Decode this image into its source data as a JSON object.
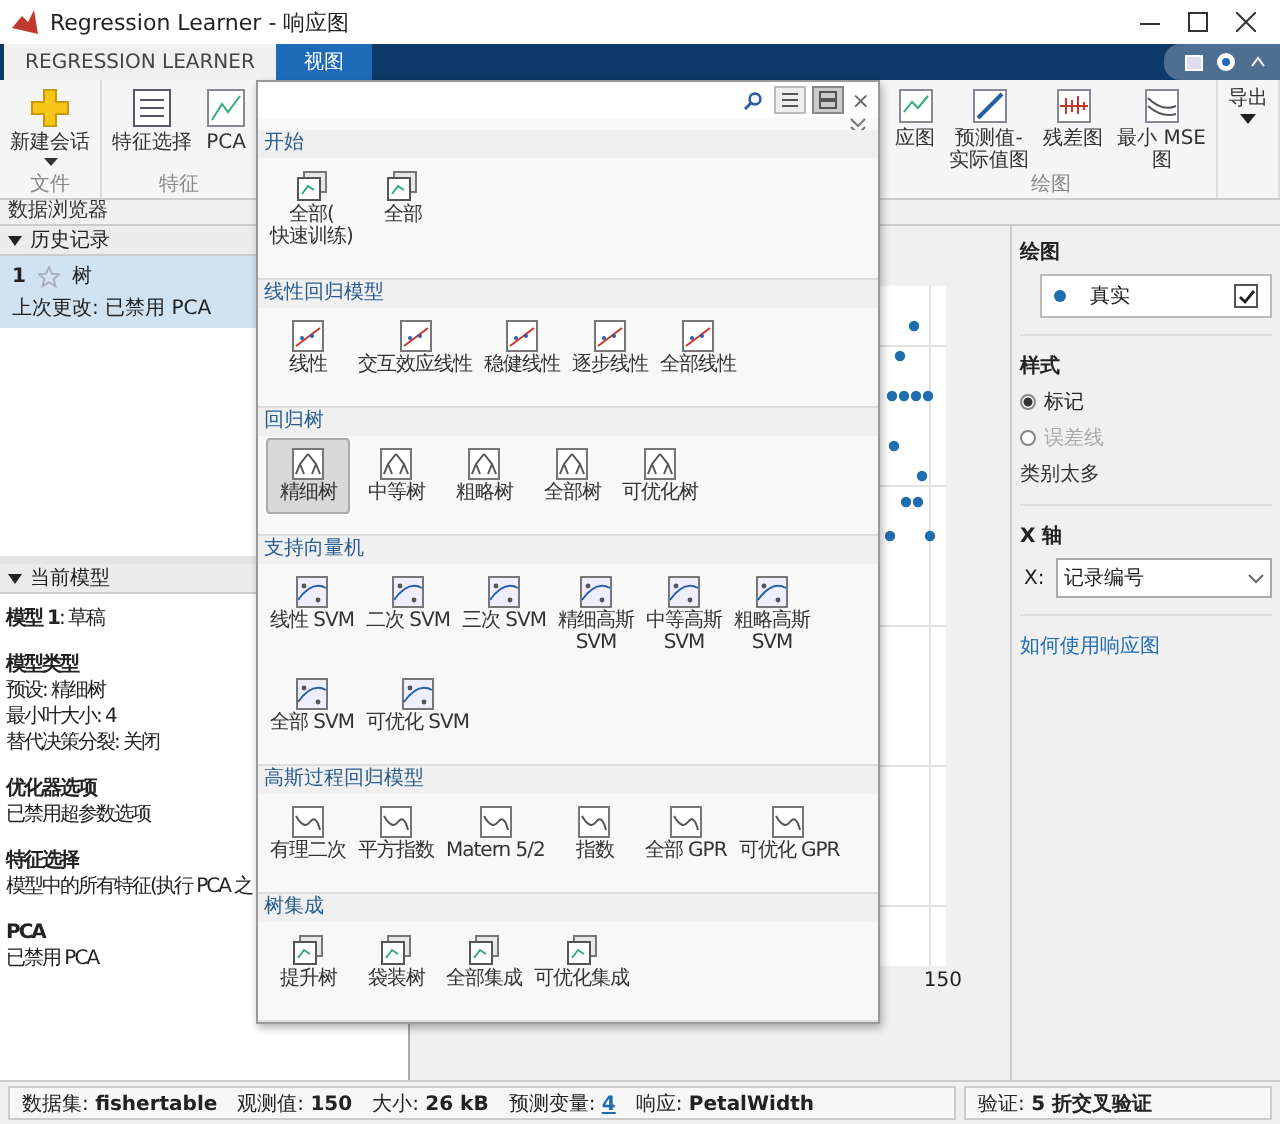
{
  "window": {
    "title": "Regression Learner - 响应图"
  },
  "tabs": [
    {
      "label": "REGRESSION LEARNER",
      "selected": true
    },
    {
      "label": "视图",
      "selected": false
    }
  ],
  "toolstrip": {
    "left_groups": [
      {
        "label": "文件",
        "buttons": [
          {
            "label": "新建会话",
            "kind": "new",
            "dropdown": true
          }
        ]
      },
      {
        "label": "特征",
        "buttons": [
          {
            "label": "特征选择",
            "kind": "list",
            "dropdown": false
          },
          {
            "label": "PCA",
            "kind": "chart",
            "dropdown": false
          }
        ]
      }
    ],
    "gallery_close": "×",
    "right_groups": [
      {
        "label": "绘图",
        "buttons": [
          {
            "label": "应图",
            "kind": "chart",
            "dropdown": false
          },
          {
            "label": "预测值-\n实际值图",
            "kind": "diagonal",
            "dropdown": false
          },
          {
            "label": "残差图",
            "kind": "residual",
            "dropdown": false
          },
          {
            "label": "最小 MSE\n图",
            "kind": "curve",
            "dropdown": false
          }
        ]
      },
      {
        "buttons": [
          {
            "label": "导出",
            "kind": "none",
            "dropdown": true
          }
        ]
      }
    ]
  },
  "data_browser": {
    "title": "数据浏览器"
  },
  "history": {
    "title": "历史记录",
    "expanded": true,
    "items": [
      {
        "index": "1",
        "name": "树",
        "favorite": false,
        "selected": true,
        "last_change": "上次更改: 已禁用 PCA"
      }
    ]
  },
  "current_model": {
    "title": "当前模型",
    "expanded": true,
    "blocks": [
      {
        "kind": "title",
        "heading": "**模型 1**: 草稿"
      },
      {
        "kind": "section",
        "heading": "模型类型",
        "lines": [
          "预设: 精细树",
          "最小叶大小: 4",
          "替代决策分裂: 关闭"
        ]
      },
      {
        "kind": "section",
        "heading": "优化器选项",
        "lines": [
          "已禁用超参数选项"
        ]
      },
      {
        "kind": "section",
        "heading": "特征选择",
        "lines": [
          "模型中的所有特征(执行 PCA 之"
        ]
      },
      {
        "kind": "section",
        "heading": "PCA",
        "lines": [
          "已禁用 PCA"
        ]
      }
    ]
  },
  "gallery": {
    "views": [
      {
        "kind": "list",
        "selected": false
      },
      {
        "kind": "grid",
        "selected": true
      }
    ],
    "sections": [
      {
        "title": "开始",
        "kind": "start",
        "items": [
          {
            "label": "全部(\n快速训练)",
            "selected": false
          },
          {
            "label": "全部",
            "selected": false
          }
        ]
      },
      {
        "title": "线性回归模型",
        "kind": "linear",
        "items": [
          {
            "label": "线性",
            "selected": false
          },
          {
            "label": "交互效应线性",
            "selected": false
          },
          {
            "label": "稳健线性",
            "selected": false
          },
          {
            "label": "逐步线性",
            "selected": false
          },
          {
            "label": "全部线性",
            "selected": false
          }
        ]
      },
      {
        "title": "回归树",
        "kind": "tree",
        "items": [
          {
            "label": "精细树",
            "selected": true
          },
          {
            "label": "中等树",
            "selected": false
          },
          {
            "label": "粗略树",
            "selected": false
          },
          {
            "label": "全部树",
            "selected": false
          },
          {
            "label": "可优化树",
            "selected": false
          }
        ]
      },
      {
        "title": "支持向量机",
        "kind": "svm",
        "items": [
          {
            "label": "线性 SVM",
            "selected": false
          },
          {
            "label": "二次 SVM",
            "selected": false
          },
          {
            "label": "三次 SVM",
            "selected": false
          },
          {
            "label": "精细高斯\nSVM",
            "selected": false
          },
          {
            "label": "中等高斯\nSVM",
            "selected": false
          },
          {
            "label": "粗略高斯\nSVM",
            "selected": false
          },
          {
            "label": "全部 SVM",
            "selected": false
          },
          {
            "label": "可优化 SVM",
            "selected": false
          }
        ]
      },
      {
        "title": "高斯过程回归模型",
        "kind": "gpr",
        "items": [
          {
            "label": "有理二次",
            "selected": false
          },
          {
            "label": "平方指数",
            "selected": false
          },
          {
            "label": "Matern 5/2",
            "selected": false
          },
          {
            "label": "指数",
            "selected": false
          },
          {
            "label": "全部 GPR",
            "selected": false
          },
          {
            "label": "可优化 GPR",
            "selected": false
          }
        ]
      },
      {
        "title": "树集成",
        "kind": "ensemble",
        "items": [
          {
            "label": "提升树",
            "selected": false
          },
          {
            "label": "袋装树",
            "selected": false
          },
          {
            "label": "全部集成",
            "selected": false
          },
          {
            "label": "可优化集成",
            "selected": false
          }
        ]
      }
    ]
  },
  "plot": {
    "x_tick_label": "150"
  },
  "options": {
    "plot": {
      "title": "绘图",
      "legend": [
        {
          "label": "真实",
          "checked": true
        }
      ]
    },
    "style": {
      "title": "样式",
      "options": [
        {
          "label": "标记",
          "selected": true,
          "disabled": false
        },
        {
          "label": "误差线",
          "selected": false,
          "disabled": true
        }
      ],
      "note": "类别太多"
    },
    "x_axis": {
      "title": "X 轴",
      "label": "X:",
      "value": "记录编号"
    },
    "help_link": "如何使用响应图"
  },
  "status_bar": {
    "items": [
      {
        "label": "数据集:",
        "value": "fishertable",
        "link": false
      },
      {
        "label": "观测值:",
        "value": "150",
        "link": false
      },
      {
        "label": "大小:",
        "value": "26 kB",
        "link": false
      },
      {
        "label": "预测变量:",
        "value": "4",
        "link": true
      },
      {
        "label": "响应:",
        "value": "PetalWidth",
        "link": false
      }
    ],
    "validation": {
      "label": "验证:",
      "value": "5 折交叉验证"
    }
  }
}
